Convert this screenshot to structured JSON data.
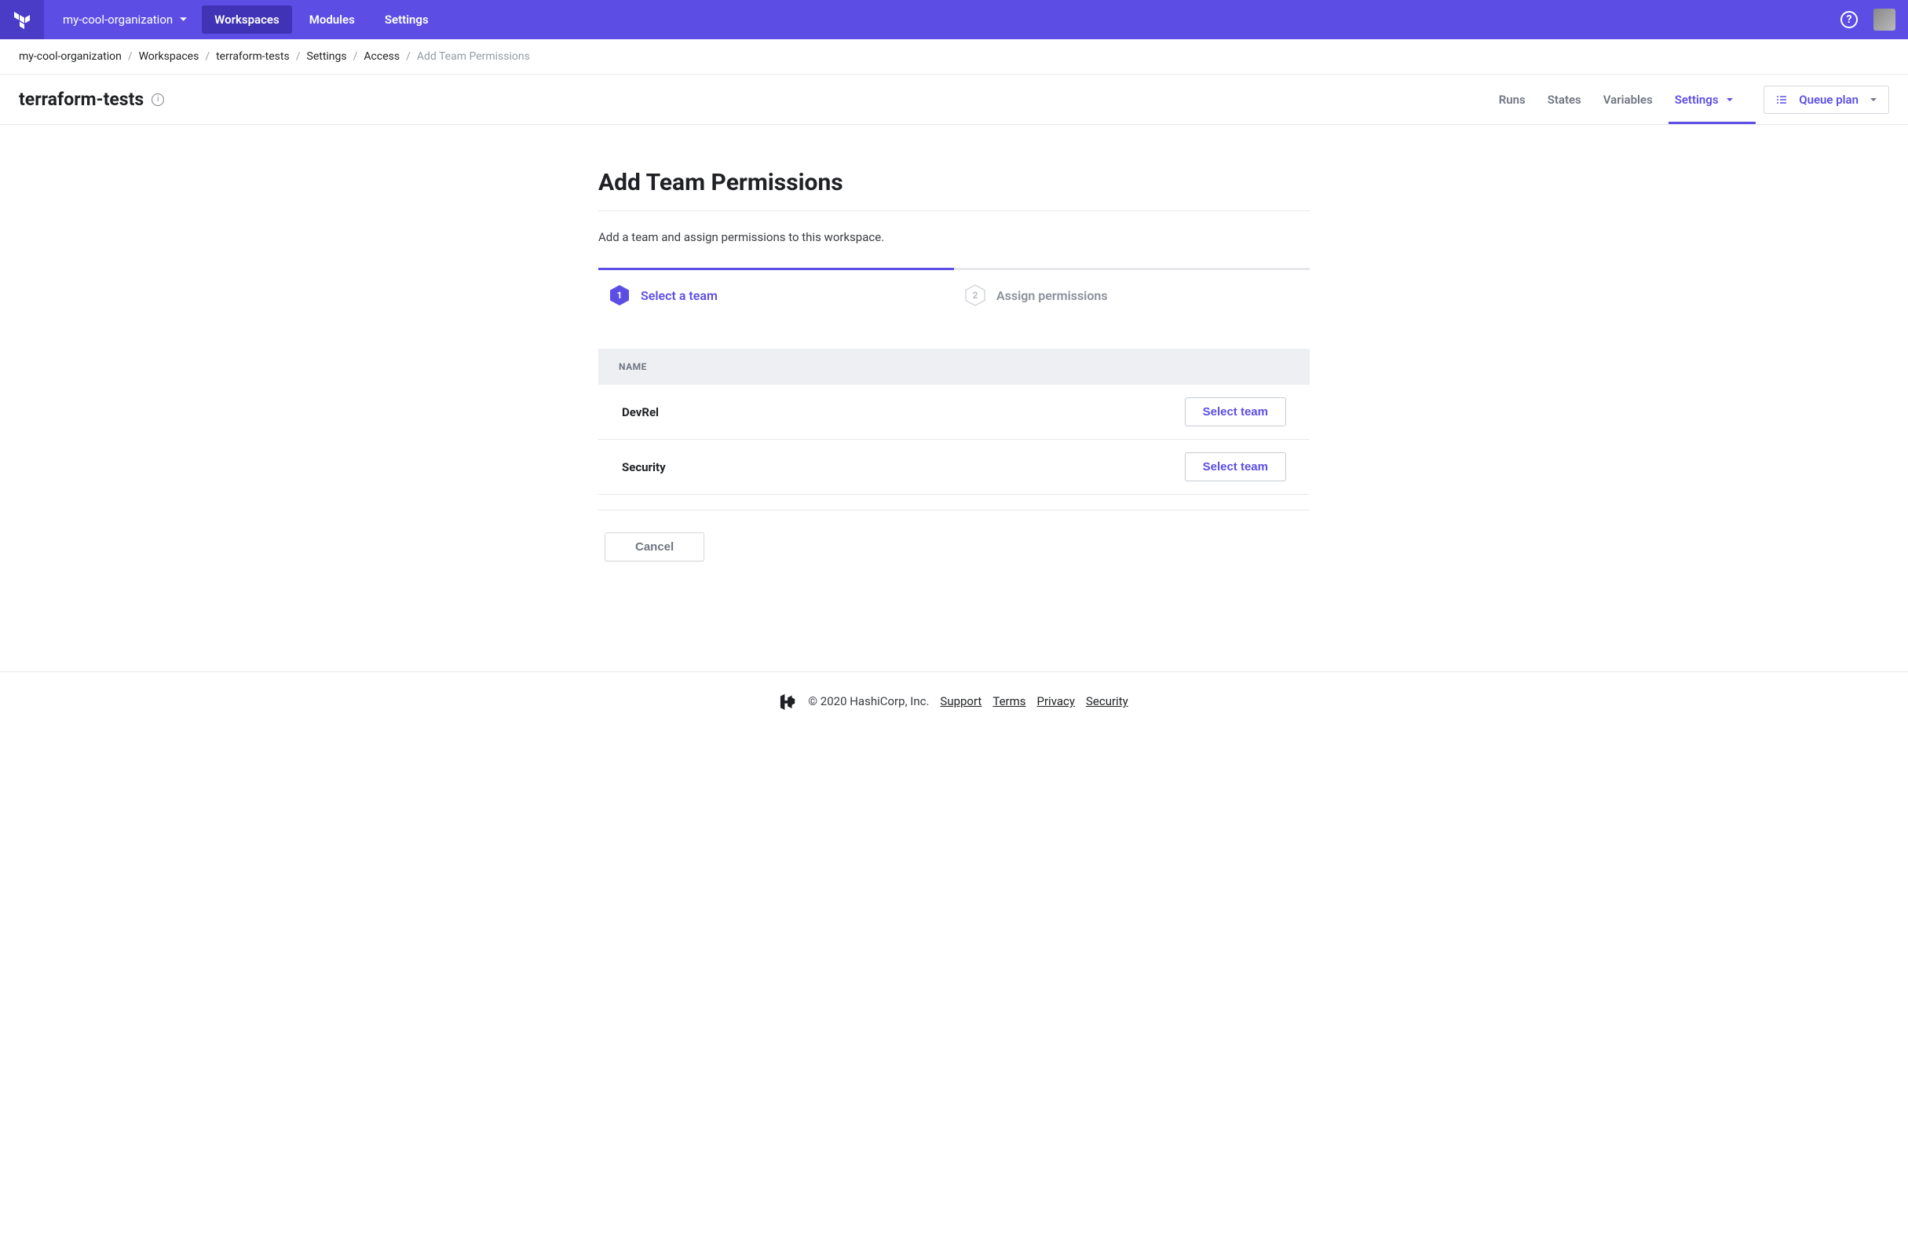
{
  "navbar": {
    "org_name": "my-cool-organization",
    "tabs": [
      {
        "label": "Workspaces",
        "active": true
      },
      {
        "label": "Modules",
        "active": false
      },
      {
        "label": "Settings",
        "active": false
      }
    ]
  },
  "breadcrumb": [
    {
      "label": "my-cool-organization",
      "current": false
    },
    {
      "label": "Workspaces",
      "current": false
    },
    {
      "label": "terraform-tests",
      "current": false
    },
    {
      "label": "Settings",
      "current": false
    },
    {
      "label": "Access",
      "current": false
    },
    {
      "label": "Add Team Permissions",
      "current": true
    }
  ],
  "workspace": {
    "name": "terraform-tests",
    "nav": [
      {
        "label": "Runs",
        "active": false,
        "chevron": false
      },
      {
        "label": "States",
        "active": false,
        "chevron": false
      },
      {
        "label": "Variables",
        "active": false,
        "chevron": false
      },
      {
        "label": "Settings",
        "active": true,
        "chevron": true
      }
    ],
    "queue_button": "Queue plan"
  },
  "page": {
    "title": "Add Team Permissions",
    "description": "Add a team and assign permissions to this workspace.",
    "steps": [
      {
        "number": "1",
        "label": "Select a team",
        "active": true
      },
      {
        "number": "2",
        "label": "Assign permissions",
        "active": false
      }
    ],
    "table": {
      "header": "NAME",
      "rows": [
        {
          "name": "DevRel",
          "button": "Select team"
        },
        {
          "name": "Security",
          "button": "Select team"
        }
      ]
    },
    "cancel_label": "Cancel"
  },
  "footer": {
    "copyright": "© 2020 HashiCorp, Inc.",
    "links": [
      "Support",
      "Terms",
      "Privacy",
      "Security"
    ]
  }
}
